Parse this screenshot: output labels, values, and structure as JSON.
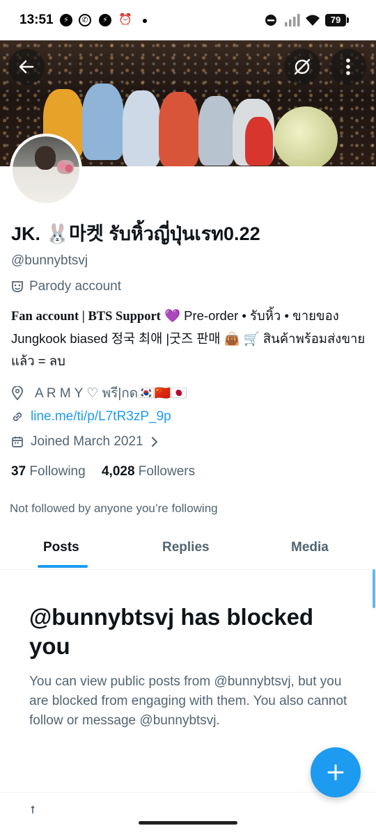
{
  "status_bar": {
    "time": "13:51",
    "battery": "79",
    "notification_icons": [
      "messenger-icon",
      "whatsapp-icon",
      "messenger-icon",
      "alarm-icon"
    ]
  },
  "profile": {
    "display_name": "JK. 🐰마켓 รับหิ้วญี่ปุ่นเรท0.22",
    "handle": "@bunnybtsvj",
    "account_label": "Parody account",
    "bio": {
      "part1": "Fan account | BTS Support",
      "part2": " 💜 Pre-order • รับหิ้ว • ขายของ Jungkook biased 정국 최애 |굿즈 판매 👜 🛒 สินค้าพร้อมส่งขายแล้ว = ลบ"
    },
    "location": "A R M Y ♡ พรี|กด🇰🇷🇨🇳🇯🇵",
    "link": "line.me/ti/p/L7tR3zP_9p",
    "joined": "Joined March 2021",
    "following_count": "37",
    "following_label": "Following",
    "followers_count": "4,028",
    "followers_label": "Followers",
    "not_followed_text": "Not followed by anyone you’re following"
  },
  "tabs": [
    {
      "label": "Posts",
      "active": true
    },
    {
      "label": "Replies",
      "active": false
    },
    {
      "label": "Media",
      "active": false
    }
  ],
  "blocked": {
    "title": "@bunnybtsvj has blocked you",
    "description": "You can view public posts from @bunnybtsvj, but you are blocked from engaging with them. You also cannot follow or message @bunnybtsvj."
  },
  "colors": {
    "accent": "#1d9bf0",
    "text_primary": "#0f1419",
    "text_secondary": "#536471"
  }
}
